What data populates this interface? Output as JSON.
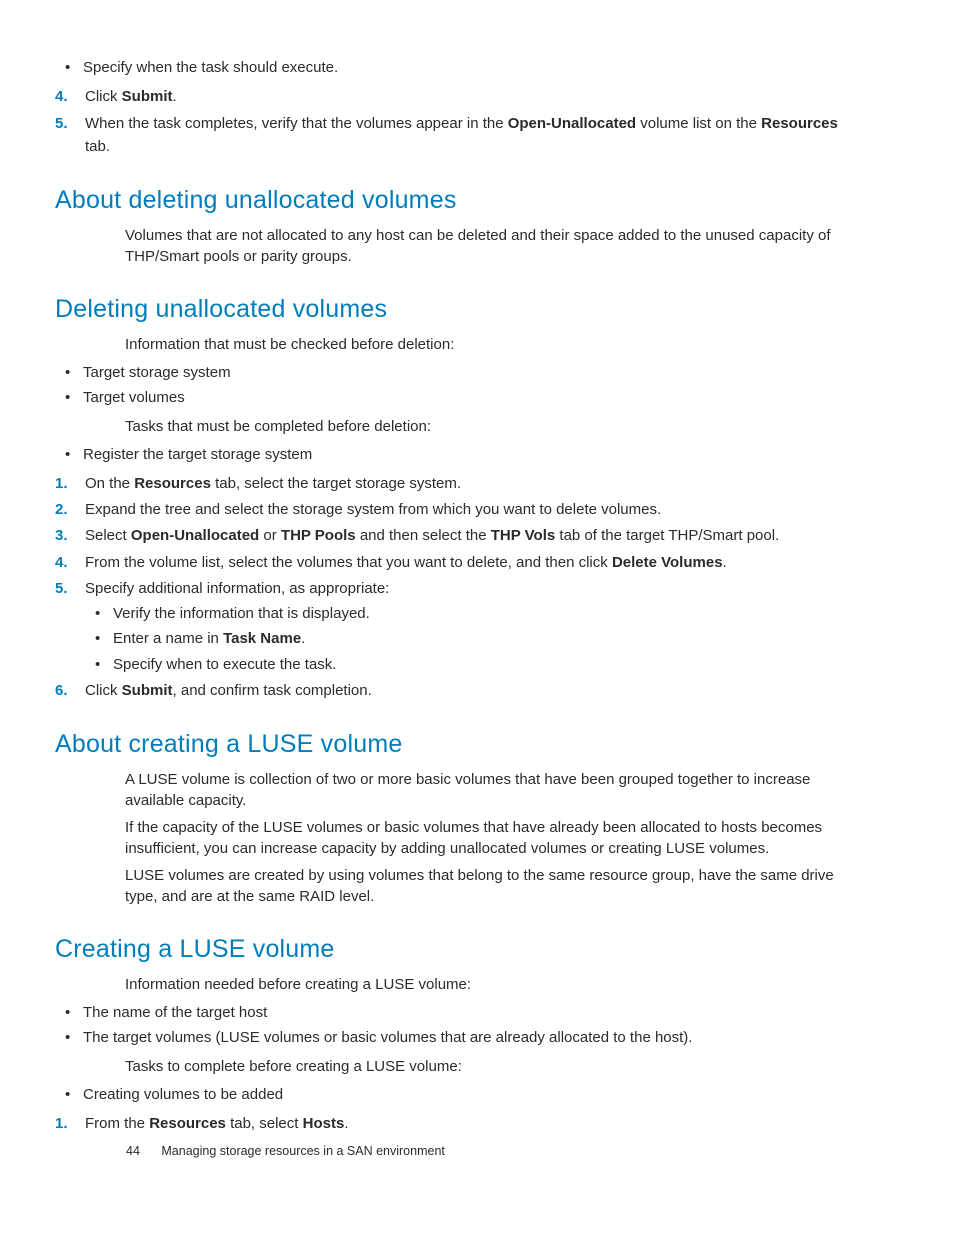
{
  "top": {
    "sub_bullet": "Specify when the task should execute.",
    "step4_num": "4.",
    "step4_a": "Click ",
    "step4_b": "Submit",
    "step4_c": ".",
    "step5_num": "5.",
    "step5_a": "When the task completes, verify that the volumes appear in the ",
    "step5_b": "Open-Unallocated",
    "step5_c": " volume list on the ",
    "step5_d": "Resources",
    "step5_e": " tab."
  },
  "about_del": {
    "heading": "About deleting unallocated volumes",
    "p1": "Volumes that are not allocated to any host can be deleted and their space added to the unused capacity of THP/Smart pools or parity groups."
  },
  "del": {
    "heading": "Deleting unallocated volumes",
    "p1": "Information that must be checked before deletion:",
    "b1": "Target storage system",
    "b2": "Target volumes",
    "p2": "Tasks that must be completed before deletion:",
    "b3": "Register the target storage system",
    "s1_num": "1.",
    "s1_a": "On the ",
    "s1_b": "Resources",
    "s1_c": " tab, select the target storage system.",
    "s2_num": "2.",
    "s2": "Expand the tree and select the storage system from which you want to delete volumes.",
    "s3_num": "3.",
    "s3_a": "Select ",
    "s3_b": "Open-Unallocated",
    "s3_c": " or ",
    "s3_d": "THP Pools",
    "s3_e": " and then select the ",
    "s3_f": "THP Vols",
    "s3_g": " tab of the target THP/Smart pool.",
    "s4_num": "4.",
    "s4_a": "From the volume list, select the volumes that you want to delete, and then click ",
    "s4_b": "Delete Volumes",
    "s4_c": ".",
    "s5_num": "5.",
    "s5": "Specify additional information, as appropriate:",
    "s5_sub1": "Verify the information that is displayed.",
    "s5_sub2_a": "Enter a name in ",
    "s5_sub2_b": "Task Name",
    "s5_sub2_c": ".",
    "s5_sub3": "Specify when to execute the task.",
    "s6_num": "6.",
    "s6_a": "Click ",
    "s6_b": "Submit",
    "s6_c": ", and confirm task completion."
  },
  "about_luse": {
    "heading": "About creating a LUSE volume",
    "p1": "A LUSE volume is collection of two or more basic volumes that have been grouped together to increase available capacity.",
    "p2": "If the capacity of the LUSE volumes or basic volumes that have already been allocated to hosts becomes insufficient, you can increase capacity by adding unallocated volumes or creating LUSE volumes.",
    "p3": "LUSE volumes are created by using volumes that belong to the same resource group, have the same drive type, and are at the same RAID level."
  },
  "create_luse": {
    "heading": "Creating a LUSE volume",
    "p1": "Information needed before creating a LUSE volume:",
    "b1": "The name of the target host",
    "b2": "The target volumes (LUSE volumes or basic volumes that are already allocated to the host).",
    "p2": "Tasks to complete before creating a LUSE volume:",
    "b3": "Creating volumes to be added",
    "s1_num": "1.",
    "s1_a": "From the ",
    "s1_b": "Resources",
    "s1_c": " tab, select ",
    "s1_d": "Hosts",
    "s1_e": "."
  },
  "footer": {
    "page": "44",
    "title": "Managing storage resources in a SAN environment"
  }
}
